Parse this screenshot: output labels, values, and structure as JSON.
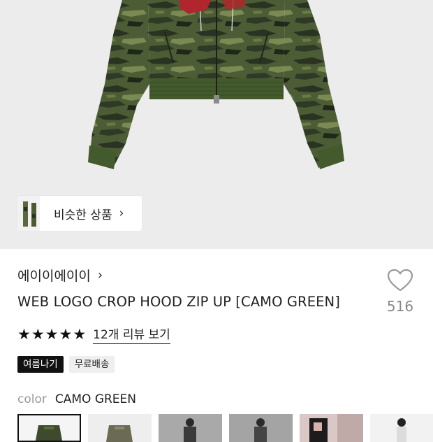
{
  "similar_products": {
    "label": "비슷한 상품",
    "chevron": "›"
  },
  "product": {
    "brand": "에이이에이이",
    "brand_chevron": "›",
    "title": "WEB LOGO CROP HOOD ZIP UP [CAMO GREEN]",
    "likes": "516",
    "rating_stars": 5,
    "review_link": "12개 리뷰 보기",
    "badges": [
      "여름나기",
      "무료배송"
    ],
    "color_label": "color",
    "color_value": "CAMO GREEN"
  },
  "colors": {
    "accent": "#111111",
    "camo_dark": "#2f3a26",
    "camo_mid": "#4d5e36",
    "camo_light": "#6f7f4a",
    "logo_red": "#b0262c"
  }
}
